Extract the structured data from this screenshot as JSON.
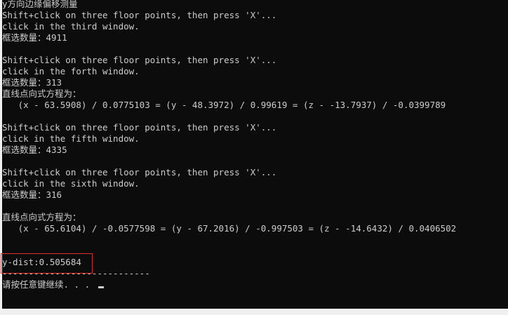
{
  "console": {
    "lines": [
      "y方向边缘偏移测量",
      "Shift+click on three floor points, then press 'X'...",
      "click in the third window.",
      "框选数量：4911",
      "",
      "Shift+click on three floor points, then press 'X'...",
      "click in the forth window.",
      "框选数量：313",
      "直线点向式方程为：",
      "   (x - 63.5908) / 0.0775103 = (y - 48.3972) / 0.99619 = (z - -13.7937) / -0.0399789",
      "",
      "Shift+click on three floor points, then press 'X'...",
      "click in the fifth window.",
      "框选数量：4335",
      "",
      "Shift+click on three floor points, then press 'X'...",
      "click in the sixth window.",
      "框选数量：316",
      "",
      "直线点向式方程为：",
      "   (x - 65.6104) / -0.0577598 = (y - 67.2016) / -0.997503 = (z - -14.6432) / 0.0406502",
      "",
      "",
      "y-dist:0.505684",
      "----------------------------",
      "请按任意键继续. . . "
    ],
    "highlighted_value": "y-dist:0.505684",
    "cursor": "block-cursor",
    "colors": {
      "background": "#0c0c0c",
      "text": "#cccccc",
      "highlight_border": "#e03030"
    }
  }
}
